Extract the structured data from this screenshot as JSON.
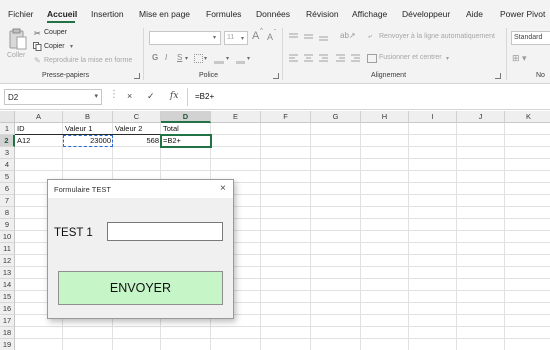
{
  "ribbon_tabs": {
    "fichier": "Fichier",
    "accueil": "Accueil",
    "insertion": "Insertion",
    "mise_en_page": "Mise en page",
    "formules": "Formules",
    "donnees": "Données",
    "revision": "Révision",
    "affichage": "Affichage",
    "developpeur": "Développeur",
    "aide": "Aide",
    "power_pivot": "Power Pivot",
    "active": "Accueil"
  },
  "clipboard": {
    "coller": "Coller",
    "couper": "Couper",
    "copier": "Copier",
    "reproduire": "Reproduire la mise en forme",
    "group_label": "Presse-papiers"
  },
  "police": {
    "font_size": "11",
    "grow_font": "A",
    "shrink_font": "A",
    "bold": "G",
    "italic": "I",
    "underline": "S",
    "group_label": "Police"
  },
  "alignement": {
    "renvoyer": "Renvoyer à la ligne automatiquement",
    "fusionner": "Fusionner et centrer",
    "group_label": "Alignement"
  },
  "nombre": {
    "format": "Standard",
    "group_label_partial": "No"
  },
  "formula_bar": {
    "name_box": "D2",
    "cancel_icon": "×",
    "enter_icon": "✓",
    "fx": "fx",
    "content": "=B2+"
  },
  "grid": {
    "columns": [
      "A",
      "B",
      "C",
      "D",
      "E",
      "F",
      "G",
      "H",
      "I",
      "J",
      "K"
    ],
    "rows": [
      "1",
      "2",
      "3",
      "4",
      "5",
      "6",
      "7",
      "8",
      "9",
      "10",
      "11",
      "12",
      "13",
      "14",
      "15",
      "16",
      "17",
      "18",
      "19"
    ],
    "selected_column": "D",
    "selected_row": "2",
    "cells": {
      "A1": "ID",
      "B1": "Valeur 1",
      "C1": "Valeur 2",
      "D1": "Total",
      "A2": "A12",
      "B2": "23000",
      "C2": "568",
      "D2": "=B2+"
    }
  },
  "userform": {
    "title": "Formulaire TEST",
    "label": "TEST 1",
    "input_value": "",
    "button": "ENVOYER",
    "button_color": "#c6f5c8",
    "close_icon": "×"
  },
  "colors": {
    "accent": "#217346",
    "ribbon_bg": "#f3f3f3",
    "dashed_copy": "#2b6bd3"
  }
}
